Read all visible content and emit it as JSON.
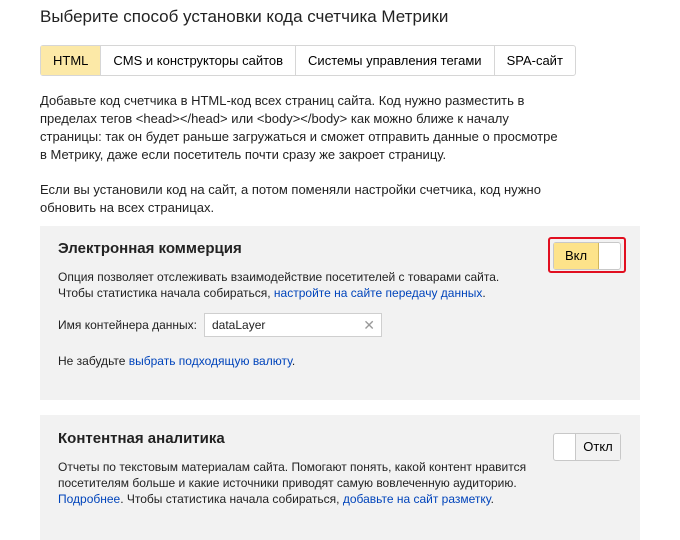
{
  "page": {
    "title": "Выберите способ установки кода счетчика Метрики"
  },
  "tabs": [
    {
      "label": "HTML",
      "active": true
    },
    {
      "label": "CMS и конструкторы сайтов",
      "active": false
    },
    {
      "label": "Системы управления тегами",
      "active": false
    },
    {
      "label": "SPA-сайт",
      "active": false
    }
  ],
  "intro": {
    "p1": "Добавьте код счетчика в HTML-код всех страниц сайта. Код нужно разместить в пределах тегов <head></head> или <body></body> как можно ближе к началу страницы: так он будет раньше загружаться и сможет отправить данные о просмотре в Метрику, даже если посетитель почти сразу же закроет страницу.",
    "p2": "Если вы установили код на сайт, а потом поменяли настройки счетчика, код нужно обновить на всех страницах."
  },
  "ecommerce": {
    "title": "Электронная коммерция",
    "toggle_label": "Вкл",
    "toggle_on": true,
    "desc_line1": "Опция позволяет отслеживать взаимодействие посетителей с товарами сайта.",
    "desc_line2": "Чтобы статистика начала собираться, ",
    "desc_link": "настройте на сайте передачу данных",
    "desc_end": ".",
    "container_label": "Имя контейнера данных:",
    "container_value": "dataLayer",
    "currency_text": "Не забудьте ",
    "currency_link": "выбрать подходящую валюту",
    "currency_end": "."
  },
  "content_analytics": {
    "title": "Контентная аналитика",
    "toggle_label": "Откл",
    "toggle_on": false,
    "desc": "Отчеты по текстовым материалам сайта. Помогают понять, какой контент нравится посетителям больше и какие источники приводят самую вовлеченную аудиторию.",
    "more_link": "Подробнее",
    "desc_mid": ". Чтобы статистика начала собираться, ",
    "markup_link": "добавьте на сайт разметку",
    "desc_end": "."
  },
  "colors": {
    "accent_yellow": "#fde38a",
    "link_blue": "#0044bb",
    "highlight_red": "#e10f20",
    "panel_bg": "#f2f2f2"
  }
}
